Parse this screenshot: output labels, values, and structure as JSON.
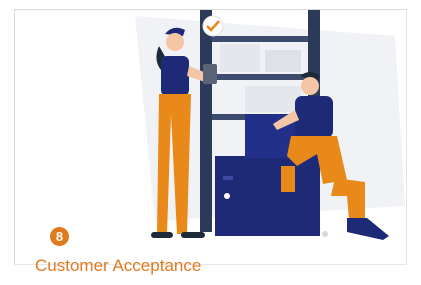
{
  "step": {
    "number": "8",
    "title": "Customer Acceptance"
  },
  "colors": {
    "accent": "#e07a1f",
    "navy": "#1e2a78",
    "orange": "#e8891a"
  },
  "icons": [
    "checkmark-bubble-icon"
  ]
}
